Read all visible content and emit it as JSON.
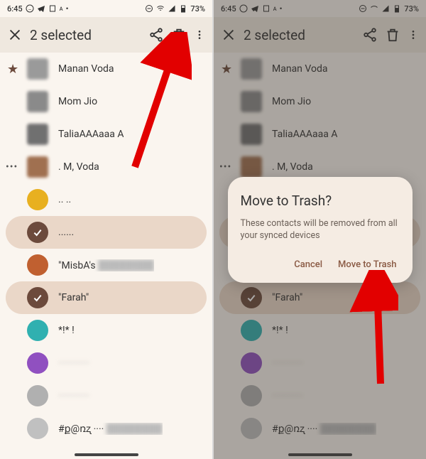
{
  "status": {
    "time": "6:45",
    "battery": "73%"
  },
  "toolbar": {
    "title": "2 selected"
  },
  "contacts": [
    {
      "name": "Manan Voda",
      "avatar_color": "#9a9a9a",
      "shape": "sq",
      "marker": "star"
    },
    {
      "name": "Mom Jio",
      "avatar_color": "#8a8a8a",
      "shape": "sq"
    },
    {
      "name": "TaliaAAAaaa A",
      "avatar_color": "#707070",
      "shape": "sq"
    },
    {
      "name": ". M, Voda",
      "avatar_color": "#a07050",
      "shape": "sq",
      "marker": "dots"
    },
    {
      "name": ".. ..",
      "avatar_color": "#e8b020",
      "shape": "round"
    },
    {
      "name": "......",
      "avatar_color": "#6c4a3c",
      "shape": "round",
      "selected": true
    },
    {
      "name": "\"MisbA's",
      "avatar_color": "#c06030",
      "shape": "round",
      "blur_tail": true
    },
    {
      "name": "\"Farah\"",
      "avatar_color": "#6c4a3c",
      "shape": "round",
      "selected": true
    },
    {
      "name": "*!* !",
      "avatar_color": "#30b0b0",
      "shape": "round"
    },
    {
      "name": "············",
      "avatar_color": "#9050c0",
      "shape": "round",
      "blur": true
    },
    {
      "name": "············",
      "avatar_color": "#b0b0b0",
      "shape": "round",
      "blur": true
    },
    {
      "name": "#ք@ռʐ  ····",
      "avatar_color": "#c0c0c0",
      "shape": "round",
      "blur_tail": true
    }
  ],
  "dialog": {
    "title": "Move to Trash?",
    "body": "These contacts will be removed from all your synced devices",
    "cancel": "Cancel",
    "confirm": "Move to Trash"
  }
}
